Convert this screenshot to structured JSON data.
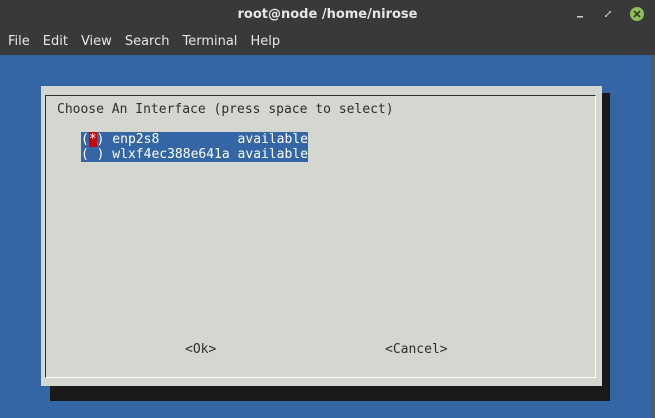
{
  "window": {
    "title": "root@node /home/nirose"
  },
  "menubar": {
    "items": [
      {
        "label": "File"
      },
      {
        "label": "Edit"
      },
      {
        "label": "View"
      },
      {
        "label": "Search"
      },
      {
        "label": "Terminal"
      },
      {
        "label": "Help"
      }
    ]
  },
  "dialog": {
    "title": "Choose An Interface (press space to select)",
    "options": [
      {
        "open": "(",
        "mark": "*",
        "close": ")",
        "name": " enp2s8          ",
        "status": "available",
        "selected": true
      },
      {
        "open": "(",
        "mark": " ",
        "close": ")",
        "name": " wlxf4ec388e641a ",
        "status": "available",
        "selected": false
      }
    ],
    "ok_label": "<Ok>",
    "cancel_label": "<Cancel>"
  },
  "colors": {
    "terminal_bg": "#3465a4",
    "dialog_bg": "#d3d7cf",
    "highlight_bg": "#3465a4",
    "cursor_bg": "#cc0000",
    "close_button": "#8fbf59"
  },
  "icons": {
    "minimize": "minimize-icon",
    "maximize": "maximize-icon",
    "close": "close-icon"
  }
}
